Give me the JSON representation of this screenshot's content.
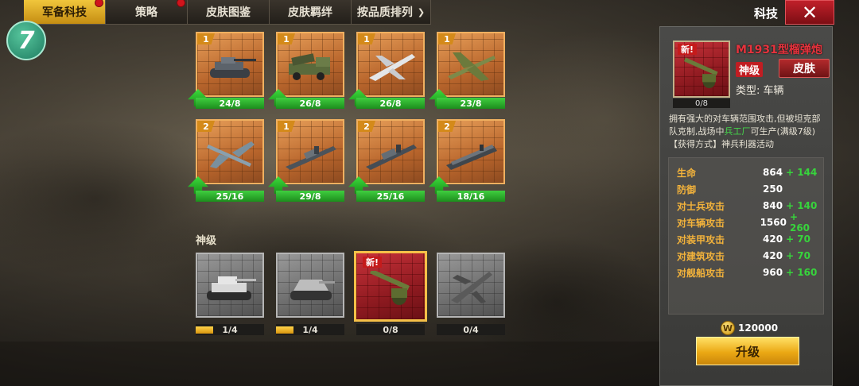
{
  "topbar": {
    "tabs": [
      {
        "label": "军备科技",
        "active": true,
        "dot": true
      },
      {
        "label": "策略",
        "active": false,
        "dot": true
      },
      {
        "label": "皮肤图鉴",
        "active": false,
        "dot": false
      },
      {
        "label": "皮肤羁绊",
        "active": false,
        "dot": false
      }
    ],
    "sort_label": "按品质排列",
    "title": "科技",
    "close_icon": "close-icon"
  },
  "badge": {
    "text": "7"
  },
  "units_row1": [
    {
      "level": "1",
      "count": "24/8",
      "upgradable": true,
      "icon": "tank-icon"
    },
    {
      "level": "1",
      "count": "26/8",
      "upgradable": true,
      "icon": "rocket-truck-icon"
    },
    {
      "level": "1",
      "count": "26/8",
      "upgradable": true,
      "icon": "jet-icon"
    },
    {
      "level": "1",
      "count": "23/8",
      "upgradable": true,
      "icon": "bomber-icon"
    }
  ],
  "units_row2": [
    {
      "level": "2",
      "count": "25/16",
      "upgradable": true,
      "icon": "flying-boat-icon"
    },
    {
      "level": "1",
      "count": "29/8",
      "upgradable": true,
      "icon": "destroyer-icon"
    },
    {
      "level": "2",
      "count": "25/16",
      "upgradable": true,
      "icon": "battleship-icon"
    },
    {
      "level": "2",
      "count": "18/16",
      "upgradable": true,
      "icon": "carrier-icon"
    }
  ],
  "section_label": "神级",
  "divine_units": [
    {
      "count": "1/4",
      "progress": 0.25,
      "style": "gray",
      "icon": "heavy-tank-icon"
    },
    {
      "count": "1/4",
      "progress": 0.25,
      "style": "gray",
      "icon": "assault-gun-icon"
    },
    {
      "count": "0/8",
      "progress": 0,
      "style": "red",
      "new": "新!",
      "icon": "howitzer-icon"
    },
    {
      "count": "0/4",
      "progress": 0,
      "style": "gray",
      "icon": "fighter-icon"
    }
  ],
  "detail": {
    "new_tag": "新!",
    "name": "M1931型榴弹炮",
    "tier": "神级",
    "skin_button": "皮肤",
    "type": "类型: 车辆",
    "count": "0/8",
    "desc_part1": "拥有强大的对车辆范围攻击,但被坦克部队克制,战场中",
    "desc_highlight": "兵工厂",
    "desc_part2": "可生产(满级7级)【获得方式】神兵利器活动",
    "stats": [
      {
        "name": "生命",
        "value": "864",
        "plus": "+ 144"
      },
      {
        "name": "防御",
        "value": "250",
        "plus": ""
      },
      {
        "name": "对士兵攻击",
        "value": "840",
        "plus": "+ 140"
      },
      {
        "name": "对车辆攻击",
        "value": "1560",
        "plus": "+ 260"
      },
      {
        "name": "对装甲攻击",
        "value": "420",
        "plus": "+ 70"
      },
      {
        "name": "对建筑攻击",
        "value": "420",
        "plus": "+ 70"
      },
      {
        "name": "对舰船攻击",
        "value": "960",
        "plus": "+ 160"
      }
    ],
    "cost_icon": "W",
    "cost": "120000",
    "upgrade_button": "升级"
  }
}
